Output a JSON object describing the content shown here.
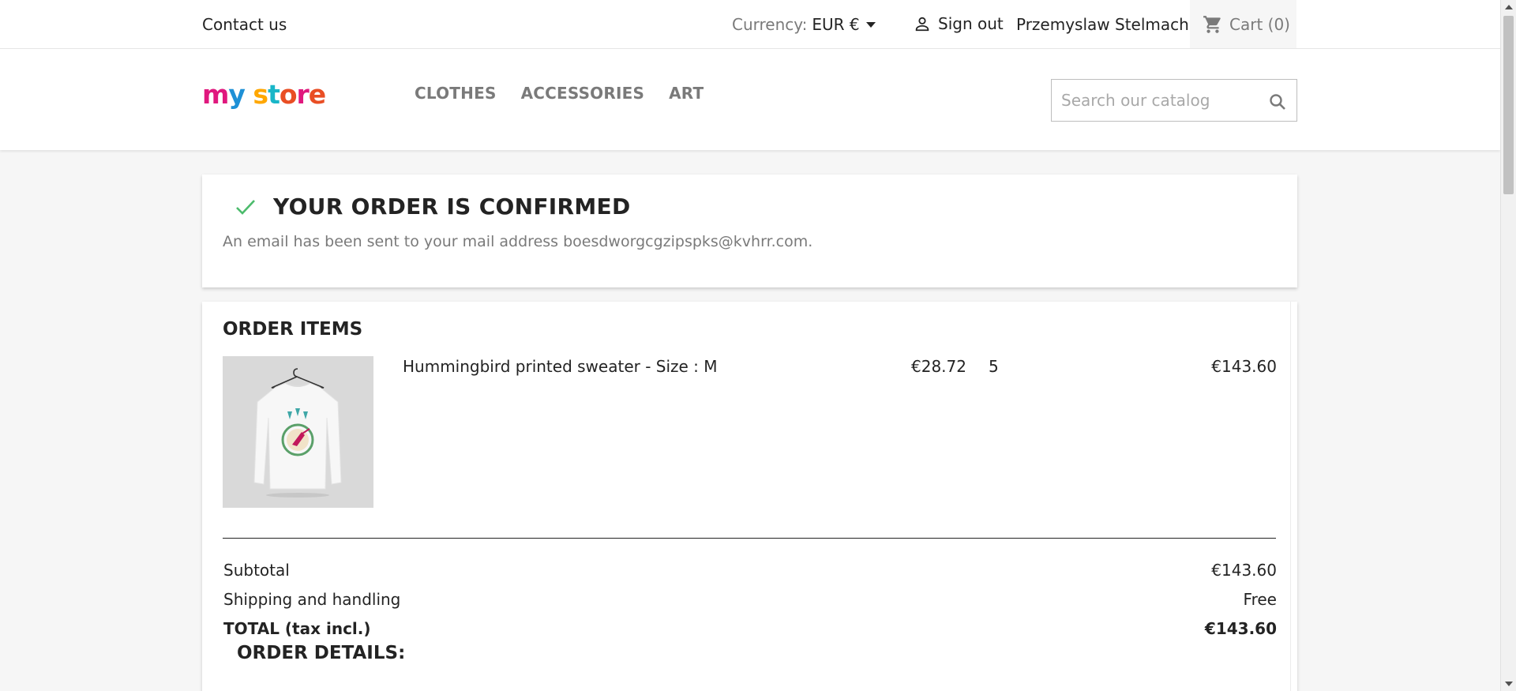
{
  "topbar": {
    "contact": "Contact us",
    "currency_label": "Currency:",
    "currency_value": "EUR €",
    "sign_out": "Sign out",
    "username": "Przemyslaw Stelmach",
    "cart": "Cart (0)"
  },
  "header": {
    "logo": {
      "w1": "m",
      "w2": "y",
      "w3": "s",
      "w4": "t",
      "w5": "o",
      "w6": "r",
      "w7": "e"
    },
    "nav": [
      "CLOTHES",
      "ACCESSORIES",
      "ART"
    ],
    "search_placeholder": "Search our catalog"
  },
  "confirmation": {
    "title": "YOUR ORDER IS CONFIRMED",
    "message": "An email has been sent to your mail address boesdworgcgzipspks@kvhrr.com."
  },
  "order_items": {
    "heading": "ORDER ITEMS",
    "items": [
      {
        "name": "Hummingbird printed sweater - Size : M",
        "unit_price": "€28.72",
        "quantity": "5",
        "total": "€143.60"
      }
    ],
    "subtotal_label": "Subtotal",
    "subtotal_value": "€143.60",
    "shipping_label": "Shipping and handling",
    "shipping_value": "Free",
    "total_label": "TOTAL (tax incl.)",
    "total_value": "€143.60"
  },
  "order_details_heading": "ORDER DETAILS:",
  "colors": {
    "accent_check": "#4cbb6c",
    "muted": "#7a7a7a",
    "text": "#232323"
  }
}
